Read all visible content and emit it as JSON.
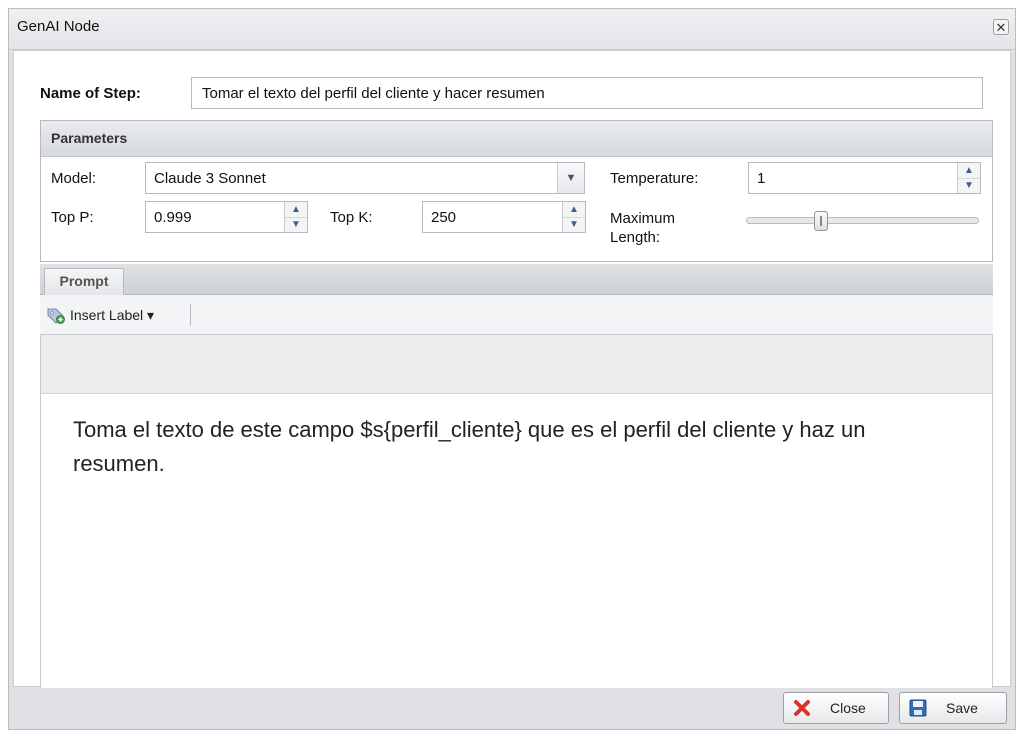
{
  "window": {
    "title": "GenAI Node",
    "close_glyph": "✕"
  },
  "step": {
    "label": "Name of Step:",
    "value": "Tomar el texto del perfil del cliente y hacer resumen"
  },
  "parameters": {
    "title": "Parameters",
    "model_label": "Model:",
    "model_value": "Claude 3 Sonnet",
    "temperature_label": "Temperature:",
    "temperature_value": "1",
    "top_p_label": "Top P:",
    "top_p_value": "0.999",
    "top_k_label": "Top K:",
    "top_k_value": "250",
    "max_length_label_line1": "Maximum",
    "max_length_label_line2": "Length:",
    "max_length_slider_fraction": 0.31
  },
  "tabs": [
    {
      "label": "Prompt",
      "active": true
    }
  ],
  "toolbar": {
    "insert_label": "Insert Label ▾",
    "insert_icon": "tag-add-icon"
  },
  "prompt": {
    "text": "Toma el texto de este campo $s{perfil_cliente} que es el perfil del cliente y haz un resumen."
  },
  "footer": {
    "close_label": "Close",
    "save_label": "Save",
    "close_icon": "red-x-icon",
    "save_icon": "floppy-disk-icon"
  },
  "colors": {
    "accent_blue": "#3f5f8a",
    "close_red": "#d9342b",
    "save_blue": "#2f6db5"
  }
}
